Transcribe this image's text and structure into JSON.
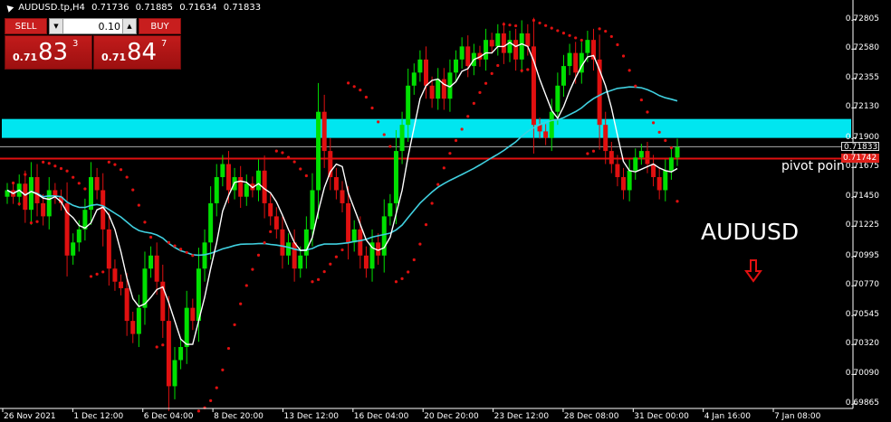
{
  "header": {
    "symbol_timeframe": "AUDUSD.tp,H4",
    "open": "0.71736",
    "high": "0.71885",
    "low": "0.71634",
    "close": "0.71833"
  },
  "trade_panel": {
    "sell_label": "SELL",
    "buy_label": "BUY",
    "lot_value": "0.10",
    "lot_down_glyph": "▼",
    "lot_up_glyph": "▲",
    "sell_prefix": "0.71",
    "sell_big": "83",
    "sell_sup": "3",
    "buy_prefix": "0.71",
    "buy_big": "84",
    "buy_sup": "7"
  },
  "price_axis": {
    "labels": [
      "0.72805",
      "0.72580",
      "0.72355",
      "0.72130",
      "0.71900",
      "0.71675",
      "0.71450",
      "0.71225",
      "0.70995",
      "0.70770",
      "0.70545",
      "0.70320",
      "0.70090",
      "0.69865"
    ],
    "bid_tag": "0.71833",
    "pivot_tag": "0.71742"
  },
  "time_axis": {
    "labels": [
      "26 Nov 2021",
      "1 Dec 12:00",
      "6 Dec 04:00",
      "8 Dec 20:00",
      "13 Dec 12:00",
      "16 Dec 04:00",
      "20 Dec 20:00",
      "23 Dec 12:00",
      "28 Dec 08:00",
      "31 Dec 00:00",
      "4 Jan 16:00",
      "7 Jan 08:00"
    ]
  },
  "annotations": {
    "pivot_text": "pivot poin",
    "symbol_text": "AUDUSD"
  },
  "colors": {
    "background": "#000000",
    "bull": "#00e000",
    "bear": "#e01010",
    "zone": "#00e6f0",
    "pivot_line": "#e01010",
    "ma_fast": "#ffffff",
    "ma_slow": "#40d0e0",
    "sar": "#e01010",
    "arrow": "#e01010"
  },
  "chart_data": {
    "type": "candlestick",
    "ylim": [
      0.6983,
      0.729
    ],
    "zone": [
      0.719,
      0.72045
    ],
    "pivot": 0.71742,
    "bid": 0.71833,
    "closes": [
      0.715,
      0.7145,
      0.7155,
      0.7135,
      0.716,
      0.714,
      0.713,
      0.715,
      0.7145,
      0.714,
      0.71,
      0.711,
      0.712,
      0.7135,
      0.716,
      0.715,
      0.712,
      0.709,
      0.708,
      0.7075,
      0.705,
      0.704,
      0.706,
      0.709,
      0.71,
      0.708,
      0.705,
      0.7,
      0.702,
      0.703,
      0.706,
      0.705,
      0.709,
      0.711,
      0.714,
      0.716,
      0.717,
      0.715,
      0.716,
      0.7145,
      0.7155,
      0.715,
      0.7165,
      0.714,
      0.713,
      0.712,
      0.71,
      0.711,
      0.709,
      0.71,
      0.712,
      0.715,
      0.721,
      0.718,
      0.716,
      0.715,
      0.714,
      0.711,
      0.712,
      0.71,
      0.709,
      0.711,
      0.71,
      0.713,
      0.714,
      0.718,
      0.72,
      0.723,
      0.724,
      0.725,
      0.723,
      0.722,
      0.7235,
      0.722,
      0.724,
      0.725,
      0.726,
      0.7245,
      0.7255,
      0.725,
      0.7265,
      0.726,
      0.727,
      0.7255,
      0.7265,
      0.725,
      0.727,
      0.726,
      0.72,
      0.7195,
      0.719,
      0.721,
      0.723,
      0.7245,
      0.7255,
      0.724,
      0.7255,
      0.7265,
      0.725,
      0.72,
      0.718,
      0.717,
      0.716,
      0.715,
      0.7165,
      0.7175,
      0.718,
      0.717,
      0.716,
      0.715,
      0.7165,
      0.7175,
      0.7183
    ]
  }
}
